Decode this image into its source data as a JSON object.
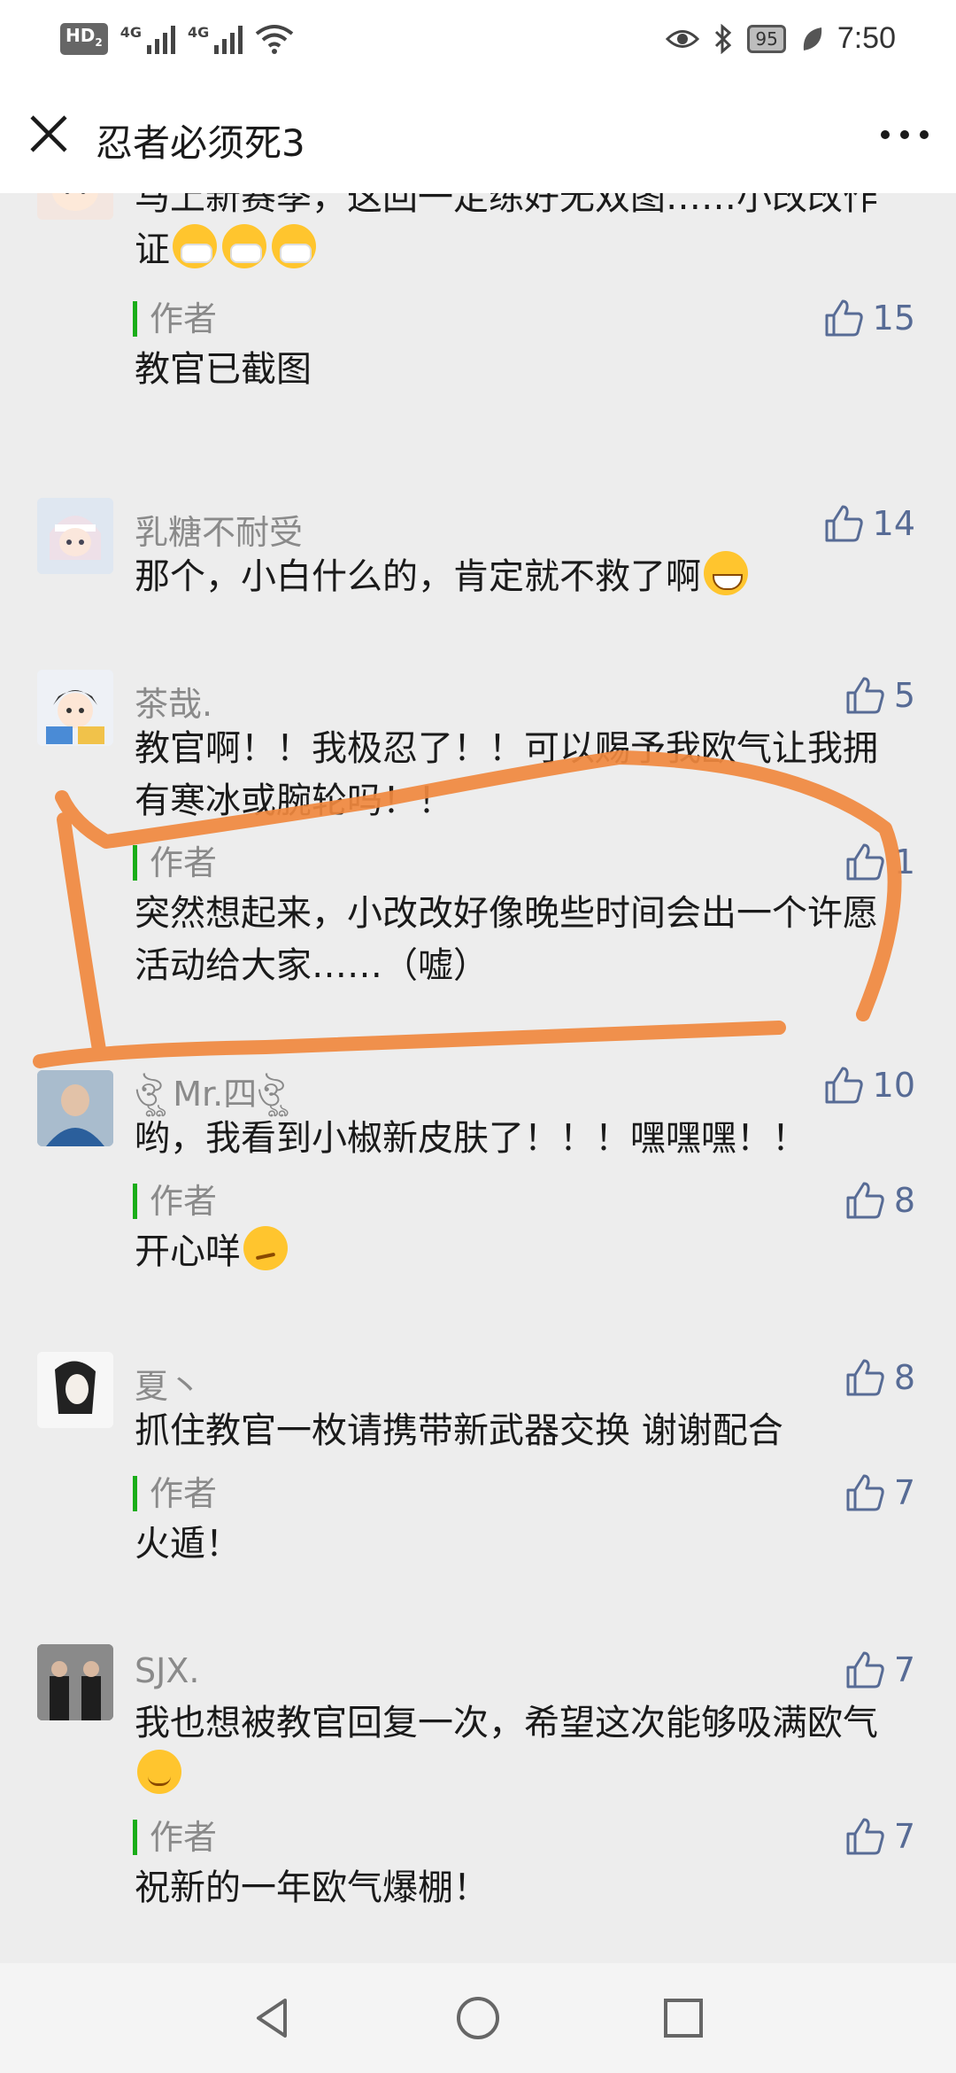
{
  "status_bar": {
    "hd_label": "HD",
    "hd_sub": "2",
    "network_1": "4G",
    "network_2": "4G",
    "battery": "95",
    "time": "7:50",
    "icons": [
      "wifi-icon",
      "eye-icon",
      "bluetooth-icon",
      "leaf-icon"
    ]
  },
  "header": {
    "title": "忍者必须死3",
    "close_icon": "close-icon",
    "more_icon": "more-icon"
  },
  "comments": [
    {
      "text": "马上新赛季，这回一定练好无双图……小改改作证",
      "emojis": [
        "mask",
        "mask",
        "mask"
      ],
      "reply": {
        "tag": "作者",
        "text": "教官已截图",
        "likes": "15"
      }
    },
    {
      "name": "乳糖不耐受",
      "text": "那个，小白什么的，肯定就不救了啊",
      "emojis": [
        "grin"
      ],
      "likes": "14"
    },
    {
      "name": "茶哉.",
      "text": "教官啊！！我极忍了！！可以赐予我欧气让我拥有寒冰或腕轮吗！！",
      "likes": "5",
      "reply": {
        "tag": "作者",
        "text": "突然想起来，小改改好像晚些时间会出一个许愿活动给大家……（嘘）",
        "likes": "1"
      }
    },
    {
      "name": "ঔৣ Mr.四ঔৣ",
      "text": "哟，我看到小椒新皮肤了！！！嘿嘿嘿！！",
      "likes": "10",
      "reply": {
        "tag": "作者",
        "text": "开心咩",
        "emojis": [
          "smirk"
        ],
        "likes": "8"
      }
    },
    {
      "name": "夏丶",
      "text": "抓住教官一枚请携带新武器交换  谢谢配合",
      "likes": "8",
      "reply": {
        "tag": "作者",
        "text": "火遁！",
        "likes": "7"
      }
    },
    {
      "name": "SJX.",
      "text": "我也想被教官回复一次，希望这次能够吸满欧气",
      "emojis": [
        "blush"
      ],
      "likes": "7",
      "reply": {
        "tag": "作者",
        "text": "祝新的一年欧气爆棚！",
        "likes": "7"
      }
    }
  ],
  "annotation": {
    "color": "#f0883e"
  },
  "nav": {
    "icons": [
      "back-icon",
      "home-icon",
      "recents-icon"
    ]
  },
  "colors": {
    "like_blue": "#576b95",
    "author_green": "#1aad19",
    "background": "#ededed"
  }
}
